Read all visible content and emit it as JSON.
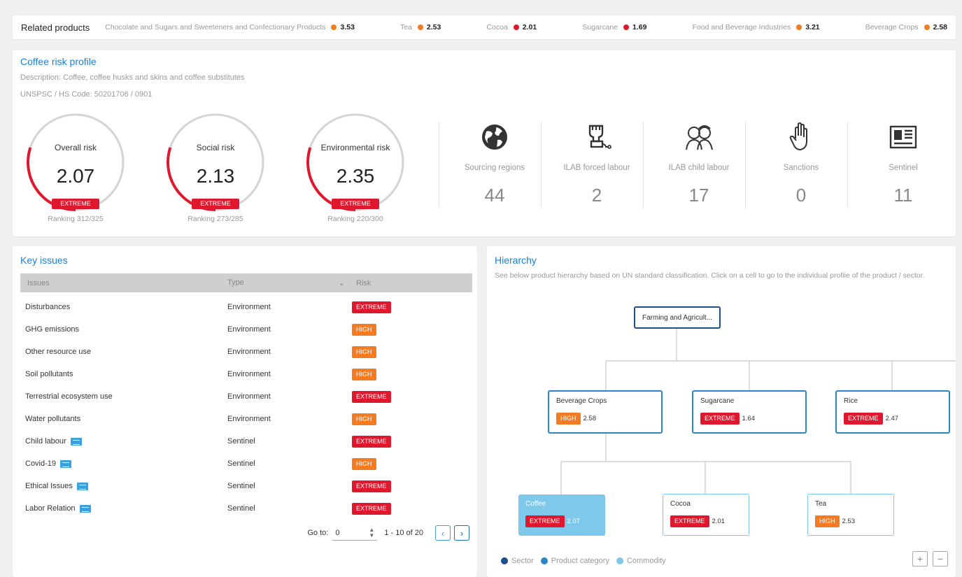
{
  "related": {
    "title": "Related products",
    "items": [
      {
        "name": "Chocolate and Sugars and Sweeteners and Confectionary Products",
        "value": "3.53",
        "color": "#f47b20"
      },
      {
        "name": "Tea",
        "value": "2.53",
        "color": "#f47b20"
      },
      {
        "name": "Cocoa",
        "value": "2.01",
        "color": "#e0182d"
      },
      {
        "name": "Sugarcane",
        "value": "1.69",
        "color": "#e0182d"
      },
      {
        "name": "Food and Beverage Industries",
        "value": "3.21",
        "color": "#f47b20"
      },
      {
        "name": "Beverage Crops",
        "value": "2.58",
        "color": "#f47b20"
      }
    ]
  },
  "profile": {
    "title": "Coffee risk profile",
    "description": "Description: Coffee, coffee husks and skins and coffee substitutes",
    "code": "UNSPSC / HS Code: 50201706 / 0901",
    "gauges": [
      {
        "label": "Overall risk",
        "value": "2.07",
        "badge": "EXTREME",
        "ranking": "Ranking 312/325",
        "fill": 0.3
      },
      {
        "label": "Social risk",
        "value": "2.13",
        "badge": "EXTREME",
        "ranking": "Ranking 273/285",
        "fill": 0.3
      },
      {
        "label": "Environmental risk",
        "value": "2.35",
        "badge": "EXTREME",
        "ranking": "Ranking 220/300",
        "fill": 0.3
      }
    ],
    "stats": [
      {
        "label": "Sourcing regions",
        "value": "44",
        "icon": "globe-icon"
      },
      {
        "label": "ILAB forced labour",
        "value": "2",
        "icon": "handcuff-fist-icon"
      },
      {
        "label": "ILAB child labour",
        "value": "17",
        "icon": "children-icon"
      },
      {
        "label": "Sanctions",
        "value": "0",
        "icon": "hand-stop-icon"
      },
      {
        "label": "Sentinel",
        "value": "11",
        "icon": "newspaper-icon"
      }
    ]
  },
  "issues": {
    "title": "Key issues",
    "headers": {
      "issue": "Issues",
      "type": "Type",
      "risk": "Risk"
    },
    "rows": [
      {
        "issue": "Disturbances",
        "type": "Environment",
        "risk": "EXTREME",
        "news": false
      },
      {
        "issue": "GHG emissions",
        "type": "Environment",
        "risk": "HIGH",
        "news": false
      },
      {
        "issue": "Other resource use",
        "type": "Environment",
        "risk": "HIGH",
        "news": false
      },
      {
        "issue": "Soil pollutants",
        "type": "Environment",
        "risk": "HIGH",
        "news": false
      },
      {
        "issue": "Terrestrial ecosystem use",
        "type": "Environment",
        "risk": "EXTREME",
        "news": false
      },
      {
        "issue": "Water pollutants",
        "type": "Environment",
        "risk": "HIGH",
        "news": false
      },
      {
        "issue": "Child labour",
        "type": "Sentinel",
        "risk": "EXTREME",
        "news": true
      },
      {
        "issue": "Covid-19",
        "type": "Sentinel",
        "risk": "HIGH",
        "news": true
      },
      {
        "issue": "Ethical Issues",
        "type": "Sentinel",
        "risk": "EXTREME",
        "news": true
      },
      {
        "issue": "Labor Relation",
        "type": "Sentinel",
        "risk": "EXTREME",
        "news": true
      }
    ],
    "pager": {
      "goto_label": "Go to:",
      "goto_value": "0",
      "range": "1 - 10 of 20"
    }
  },
  "hierarchy": {
    "title": "Hierarchy",
    "description": "See below product hierarchy based on UN standard classification. Click on a cell to go to the individual profile of the product / sector.",
    "nodes": {
      "sector": {
        "label": "Farming and Agricult..."
      },
      "beverage": {
        "label": "Beverage Crops",
        "badge": "HIGH",
        "value": "2.58"
      },
      "sugarcane": {
        "label": "Sugarcane",
        "badge": "EXTREME",
        "value": "1.64"
      },
      "rice": {
        "label": "Rice",
        "badge": "EXTREME",
        "value": "2.47"
      },
      "coffee": {
        "label": "Coffee",
        "badge": "EXTREME",
        "value": "2.07"
      },
      "cocoa": {
        "label": "Cocoa",
        "badge": "EXTREME",
        "value": "2.01"
      },
      "tea": {
        "label": "Tea",
        "badge": "HIGH",
        "value": "2.53"
      }
    },
    "legend": [
      {
        "label": "Sector",
        "color": "#1a4f8f"
      },
      {
        "label": "Product category",
        "color": "#2a86c4"
      },
      {
        "label": "Commodity",
        "color": "#7ec8ec"
      }
    ],
    "zoom_in": "+",
    "zoom_out": "−"
  },
  "colors": {
    "accent": "#1a7fd4",
    "extreme": "#e0182d",
    "high": "#f47b20"
  }
}
